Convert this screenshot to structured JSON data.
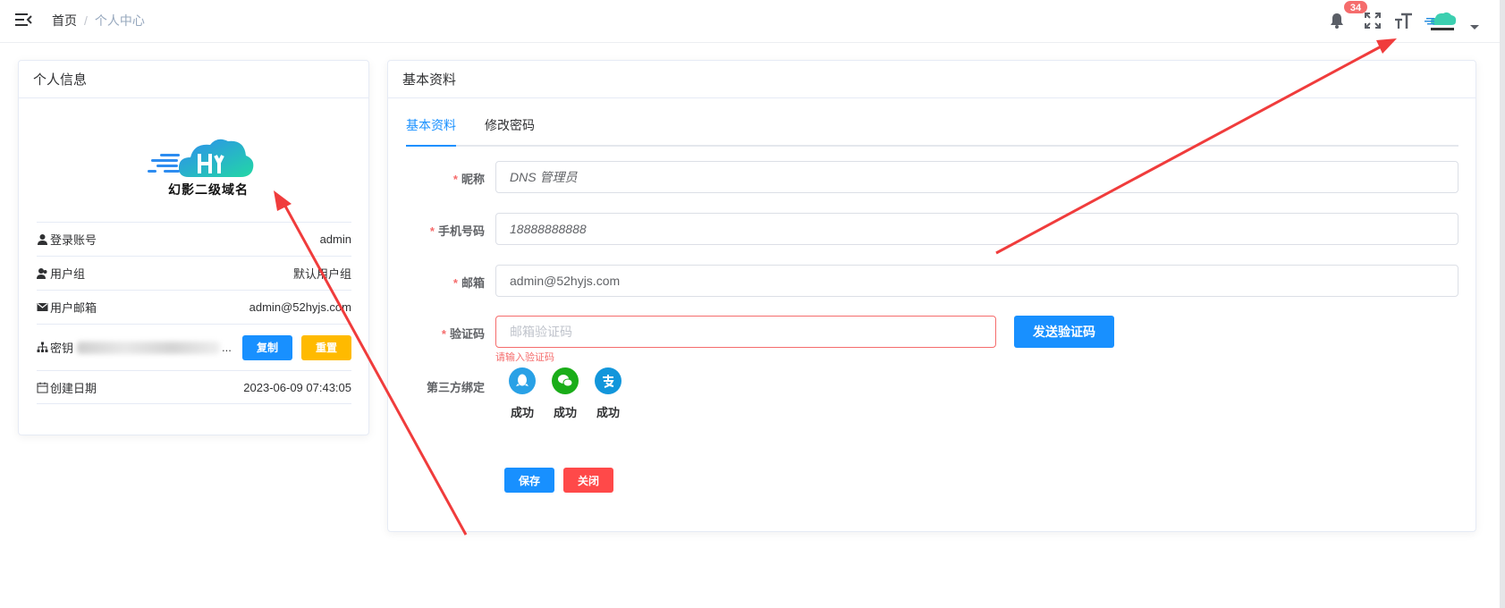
{
  "navbar": {
    "breadcrumb_home": "首页",
    "breadcrumb_sep": "/",
    "breadcrumb_current": "个人中心",
    "badge_count": "34"
  },
  "left_card": {
    "title": "个人信息",
    "logo_text": "幻影二级域名",
    "rows": [
      {
        "label": "登录账号",
        "value": "admin",
        "icon": "user-icon"
      },
      {
        "label": "用户组",
        "value": "默认用户组",
        "icon": "users-icon"
      },
      {
        "label": "用户邮箱",
        "value": "admin@52hyjs.com",
        "icon": "mail-icon"
      },
      {
        "label": "密钥",
        "value": "...",
        "icon": "tree-icon"
      },
      {
        "label": "创建日期",
        "value": "2023-06-09 07:43:05",
        "icon": "calendar-icon"
      }
    ],
    "copy_label": "复制",
    "reset_label": "重置"
  },
  "right_card": {
    "title": "基本资料",
    "tabs": [
      {
        "label": "基本资料"
      },
      {
        "label": "修改密码"
      }
    ],
    "form": {
      "nickname_label": "昵称",
      "nickname_value": "DNS 管理员",
      "phone_label": "手机号码",
      "phone_value": "18888888888",
      "email_label": "邮箱",
      "email_value": "admin@52hyjs.com",
      "code_label": "验证码",
      "code_placeholder": "邮箱验证码",
      "code_error": "请输入验证码",
      "send_code_label": "发送验证码",
      "third_party_label": "第三方绑定",
      "required_mark": "*",
      "social": [
        {
          "name": "qq-icon",
          "status": "成功",
          "color": "#29a1e6"
        },
        {
          "name": "wechat-icon",
          "status": "成功",
          "color": "#1aad19"
        },
        {
          "name": "alipay-icon",
          "status": "成功",
          "color": "#1296db"
        }
      ]
    },
    "save_label": "保存",
    "close_label": "关闭"
  },
  "colors": {
    "primary": "#1890ff",
    "warning": "#ffba00",
    "danger": "#ff4949",
    "annotation_arrow": "#f03c3c"
  }
}
